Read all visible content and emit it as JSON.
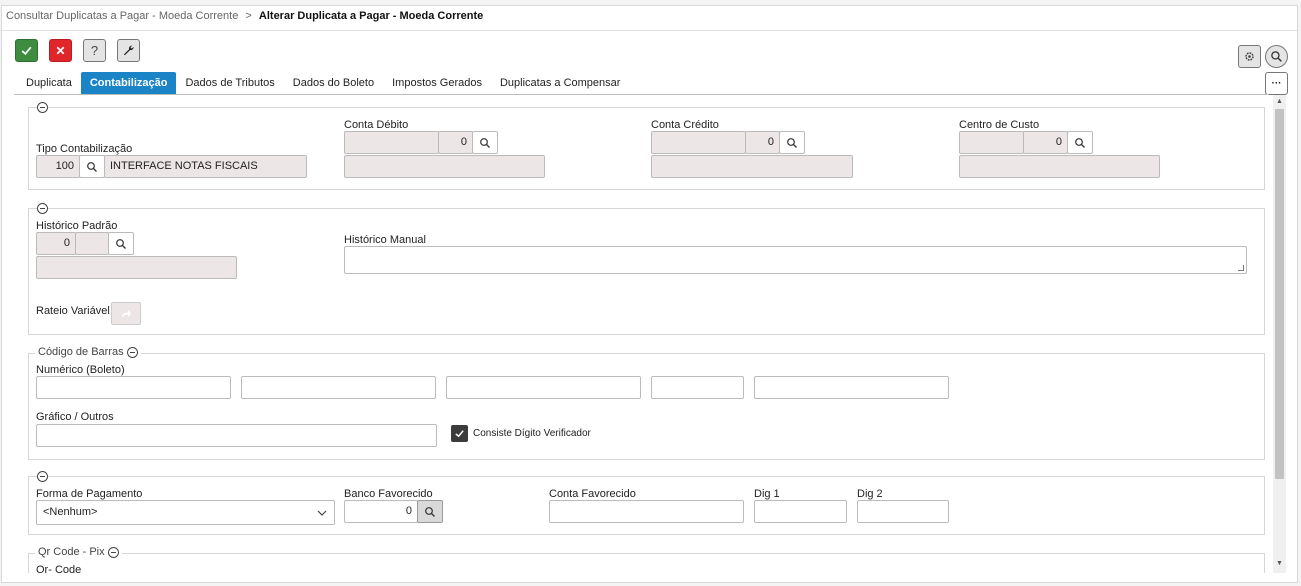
{
  "breadcrumb": {
    "parent": "Consultar Duplicatas a Pagar - Moeda Corrente",
    "separator": ">",
    "current": "Alterar Duplicata a Pagar - Moeda Corrente"
  },
  "toolbar": {
    "confirm_icon": "check-icon",
    "cancel_icon": "close-icon",
    "help_label": "?",
    "tools_icon": "wrench-icon",
    "settings_icon": "gear-icon",
    "search_icon": "search-icon",
    "more_label": "···"
  },
  "colors": {
    "confirm": "#3d8c40",
    "cancel": "#e0262b",
    "active_tab": "#1a84c7",
    "readonly_field": "#ece6e7"
  },
  "tabs": [
    {
      "label": "Duplicata",
      "active": false
    },
    {
      "label": "Contabilização",
      "active": true
    },
    {
      "label": "Dados de Tributos",
      "active": false
    },
    {
      "label": "Dados do Boleto",
      "active": false
    },
    {
      "label": "Impostos Gerados",
      "active": false
    },
    {
      "label": "Duplicatas a Compensar",
      "active": false
    }
  ],
  "contab": {
    "tipo_label": "Tipo Contabilização",
    "tipo_code": "100",
    "tipo_desc": "INTERFACE NOTAS FISCAIS",
    "debito_label": "Conta Débito",
    "debito_value": "0",
    "credito_label": "Conta Crédito",
    "credito_value": "0",
    "centro_label": "Centro de Custo",
    "centro_value": "0"
  },
  "historico": {
    "padrao_label": "Histórico Padrão",
    "padrao_value": "0",
    "manual_label": "Histórico Manual",
    "rateio_label": "Rateio Variável"
  },
  "barcode": {
    "legend": "Código de Barras",
    "numerico_label": "Numérico (Boleto)",
    "grafico_label": "Gráfico / Outros",
    "checkbox_label": "Consiste Dígito Verificador",
    "checkbox_checked": true
  },
  "pagamento": {
    "forma_label": "Forma de Pagamento",
    "forma_value": "<Nenhum>",
    "banco_label": "Banco Favorecido",
    "banco_value": "0",
    "conta_label": "Conta Favorecido",
    "dig1_label": "Dig 1",
    "dig2_label": "Dig 2"
  },
  "qrcode": {
    "legend": "Qr Code - Pix",
    "label": "Qr- Code"
  }
}
